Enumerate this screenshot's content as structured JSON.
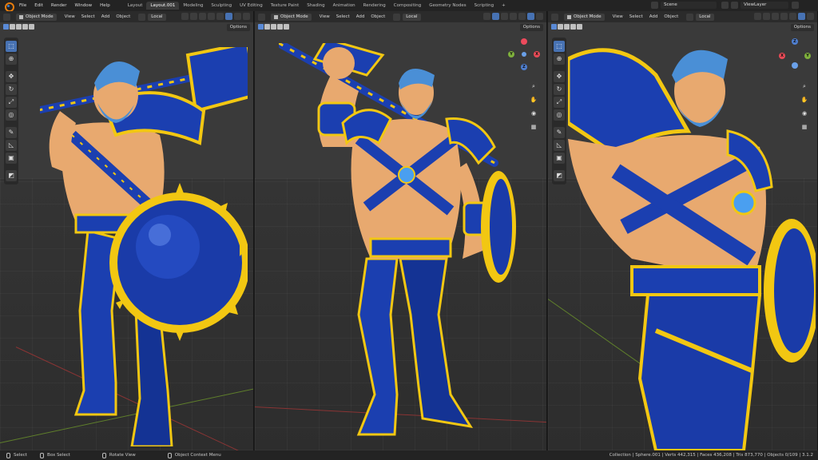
{
  "topbar": {
    "menus": [
      "File",
      "Edit",
      "Render",
      "Window",
      "Help"
    ],
    "workspaces": [
      {
        "label": "Layout",
        "active": false
      },
      {
        "label": "Layout.001",
        "active": true
      },
      {
        "label": "Modeling",
        "active": false
      },
      {
        "label": "Sculpting",
        "active": false
      },
      {
        "label": "UV Editing",
        "active": false
      },
      {
        "label": "Texture Paint",
        "active": false
      },
      {
        "label": "Shading",
        "active": false
      },
      {
        "label": "Animation",
        "active": false
      },
      {
        "label": "Rendering",
        "active": false
      },
      {
        "label": "Compositing",
        "active": false
      },
      {
        "label": "Geometry Nodes",
        "active": false
      },
      {
        "label": "Scripting",
        "active": false
      }
    ],
    "add_workspace": "+",
    "scene": "Scene",
    "view_layer": "ViewLayer"
  },
  "viewport": {
    "mode": "Object Mode",
    "menus": [
      "View",
      "Select",
      "Add",
      "Object"
    ],
    "pivot": "Local",
    "options": "Options"
  },
  "gizmo": {
    "x": "X",
    "y": "Y",
    "z": "Z"
  },
  "status": {
    "select": "Select",
    "box_select": "Box Select",
    "rotate_view": "Rotate View",
    "context_menu": "Object Context Menu",
    "stats": "Collection | Sphere.001 | Verts 442,315 | Faces 436,208 | Tris 873,770 | Objects 0/109 | 3.1.2"
  },
  "colors": {
    "accent": "#4772b3",
    "armor_blue": "#1b3fb0",
    "armor_gold": "#f2c712",
    "skin": "#e8a96f",
    "hair": "#4a8fd6"
  }
}
